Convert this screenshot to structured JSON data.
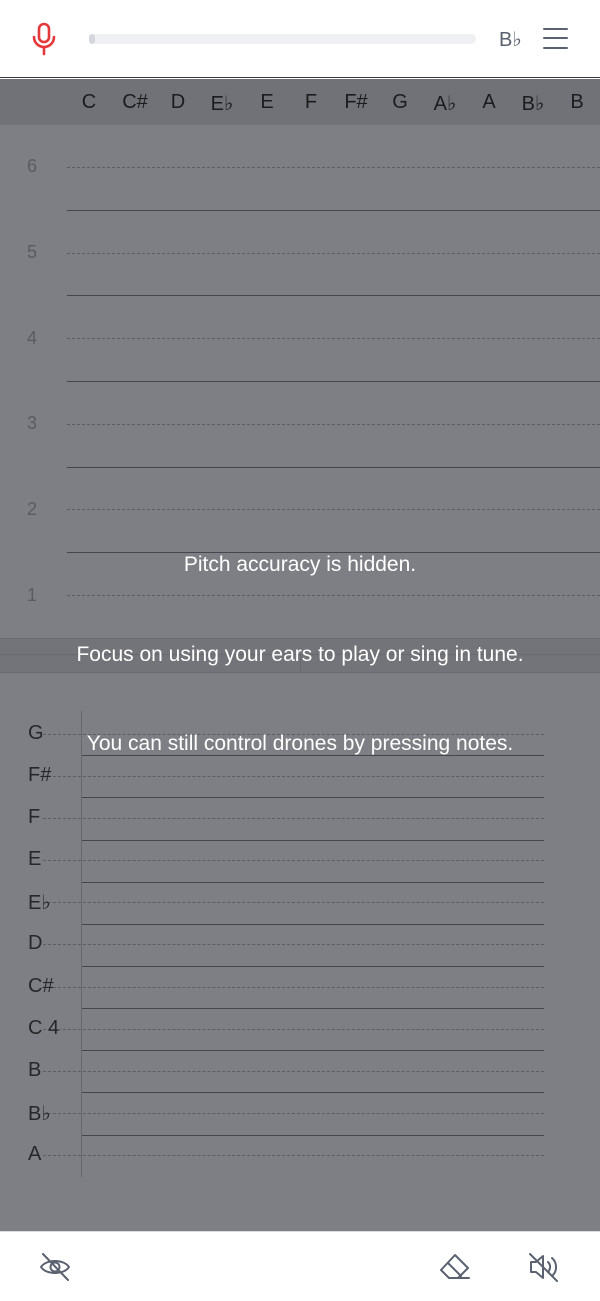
{
  "header": {
    "key_label": "B♭",
    "progress": 0.01,
    "mic_color": "#e5383b"
  },
  "note_row": {
    "notes": [
      "C",
      "C#",
      "D",
      "E♭",
      "E",
      "F",
      "F#",
      "G",
      "A♭",
      "A",
      "B♭",
      "B"
    ]
  },
  "octave_labels": [
    "6",
    "5",
    "4",
    "3",
    "2",
    "1"
  ],
  "pitch_labels": [
    "G",
    "F#",
    "F",
    "E",
    "E♭",
    "D",
    "C#",
    "C 4",
    "B",
    "B♭",
    "A"
  ],
  "overlay": {
    "line1": "Pitch accuracy is hidden.",
    "line2": "Focus on using your ears to play or sing in tune.",
    "line3": "You can still control drones by pressing notes."
  },
  "footer": {
    "icons": [
      "eye-off-icon",
      "eraser-icon",
      "volume-mute-icon"
    ]
  }
}
